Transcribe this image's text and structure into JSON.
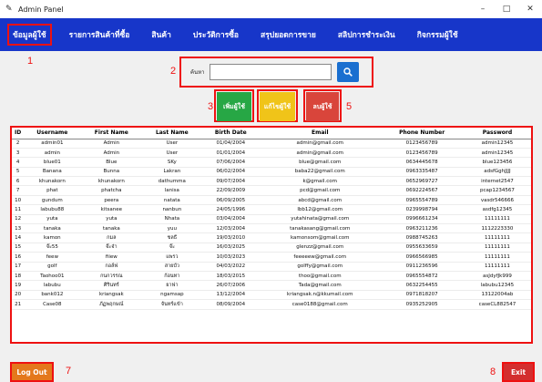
{
  "window": {
    "title": "Admin Panel",
    "icon": "feather-icon",
    "controls": [
      "–",
      "□",
      "✕"
    ]
  },
  "nav": {
    "items": [
      {
        "label": "ข้อมูลผู้ใช้",
        "active": true
      },
      {
        "label": "รายการสินค้าที่ซื้อ"
      },
      {
        "label": "สินค้า"
      },
      {
        "label": "ประวัติการซื้อ"
      },
      {
        "label": "สรุปยอดการขาย"
      },
      {
        "label": "สลิปการชำระเงิน"
      },
      {
        "label": "กิจกรรมผู้ใช้"
      }
    ]
  },
  "markers": [
    "1",
    "2",
    "3",
    "4",
    "5",
    "6",
    "7",
    "8"
  ],
  "search": {
    "label": "ค้นหา",
    "value": "",
    "icon": "search-icon"
  },
  "actions": {
    "add_label": "เพิ่มผู้ใช้",
    "edit_label": "แก้ไขผู้ใช้",
    "delete_label": "ลบผู้ใช้",
    "add_color": "#27a745",
    "edit_color": "#f0c419",
    "delete_color": "#d9453b"
  },
  "table": {
    "columns": [
      "ID",
      "Username",
      "First Name",
      "Last Name",
      "Birth Date",
      "Email",
      "Phone Number",
      "Password"
    ],
    "rows": [
      [
        "2",
        "admin01",
        "Admin",
        "User",
        "01/04/2004",
        "admin@gmail.com",
        "0123456789",
        "admin12345"
      ],
      [
        "3",
        "admin",
        "Admin",
        "User",
        "01/01/2004",
        "admin@gmail.com",
        "0123456789",
        "admin12345"
      ],
      [
        "4",
        "blue01",
        "Blue",
        "SKy",
        "07/06/2004",
        "blue@gmail.com",
        "0634445678",
        "blue123456"
      ],
      [
        "5",
        "Banana",
        "Bunna",
        "Lakran",
        "06/02/2004",
        "baba22@gmail.com",
        "0963335487",
        "adsfGghJJJJ"
      ],
      [
        "6",
        "khunakorn",
        "khunakorn",
        "dathumma",
        "09/07/2004",
        "k@gmail.com",
        "0652969727",
        "internet2547"
      ],
      [
        "7",
        "phat",
        "phatcha",
        "lanisa",
        "22/09/2009",
        "pcd@gmail.com",
        "0692224567",
        "pcap1234567"
      ],
      [
        "10",
        "gundum",
        "peera",
        "natata",
        "06/09/2005",
        "abcd@gmail.com",
        "0965554789",
        "vasdr546666"
      ],
      [
        "11",
        "labubu88",
        "kitsanee",
        "nanbun",
        "24/05/1996",
        "lbb12@gmail.com",
        "0239998794",
        "asdfg12345"
      ],
      [
        "12",
        "yuta",
        "yuta",
        "Nhata",
        "03/04/2004",
        "yutahinata@gmail.com",
        "0996661234",
        "11111111"
      ],
      [
        "13",
        "tanaka",
        "tanaka",
        "yuu",
        "12/03/2004",
        "tanakasang@gmail.com",
        "0963211236",
        "1112223330"
      ],
      [
        "14",
        "kamon",
        "กมล",
        "ชลธี",
        "19/03/2010",
        "kamonsom@gmail.com",
        "0988745263",
        "11111111"
      ],
      [
        "15",
        "จ๊ะ55",
        "จ๊ะจ๋า",
        "จ๊ะ",
        "16/03/2025",
        "glenzz@gmail.com",
        "0955633659",
        "11111111"
      ],
      [
        "16",
        "feew",
        "fiiew",
        "แพรว",
        "10/03/2023",
        "feeeeew@gmail.com",
        "0966566985",
        "11111111"
      ],
      [
        "17",
        "golf",
        "กอล์ฟ",
        "สายบัว",
        "04/03/2022",
        "golffy@gmail.com",
        "0911236596",
        "11111111"
      ],
      [
        "18",
        "Taohoo01",
        "กนกวรรณ",
        "ก้อนทา",
        "18/03/2015",
        "thoo@gmail.com",
        "0965554872",
        "asJdyfJk999"
      ],
      [
        "19",
        "labubu",
        "ศิรินทร์",
        "ยาฟา",
        "26/07/2006",
        "Tada@gmail.com",
        "0632254455",
        "labubu12345"
      ],
      [
        "20",
        "bank012",
        "kriangsak",
        "ngamsap",
        "13/12/2004",
        "kriangsak.n@kkumail.com",
        "0971818207",
        "13122004ab"
      ],
      [
        "21",
        "Case08",
        "ภัฏพฤกษณ์",
        "จันทร์แข้า",
        "08/09/2004",
        "case0188@gmail.com",
        "0935252905",
        "caseCL882547"
      ]
    ]
  },
  "footer": {
    "logout_label": "Log Out",
    "exit_label": "Exit",
    "logout_color": "#e4781c",
    "exit_color": "#d32f2f"
  }
}
